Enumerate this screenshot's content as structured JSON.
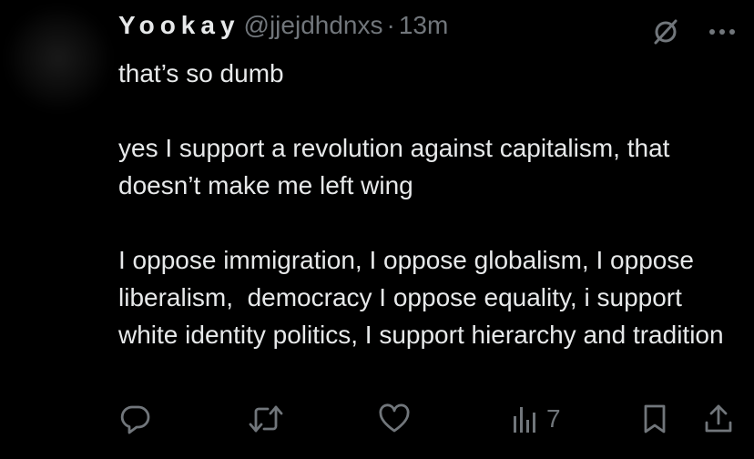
{
  "tweet": {
    "display_name": "Yookay",
    "handle": "@jjejdhdnxs",
    "separator": "·",
    "time": "13m",
    "paragraphs": [
      "that’s so dumb",
      "yes I support a revolution against capitalism, that doesn’t make me left wing",
      "I oppose immigration, I oppose globalism, I oppose liberalism,  democracy I oppose equality, i support white identity politics, I support hierarchy and tradition"
    ],
    "views": "7"
  },
  "icons": {
    "top": [
      "grok-slash-icon",
      "more-icon"
    ],
    "actions": [
      "reply-icon",
      "retweet-icon",
      "like-icon",
      "views-icon",
      "bookmark-icon",
      "share-icon"
    ]
  },
  "colors": {
    "background": "#000000",
    "text": "#e7e9ea",
    "secondary": "#71767b"
  }
}
